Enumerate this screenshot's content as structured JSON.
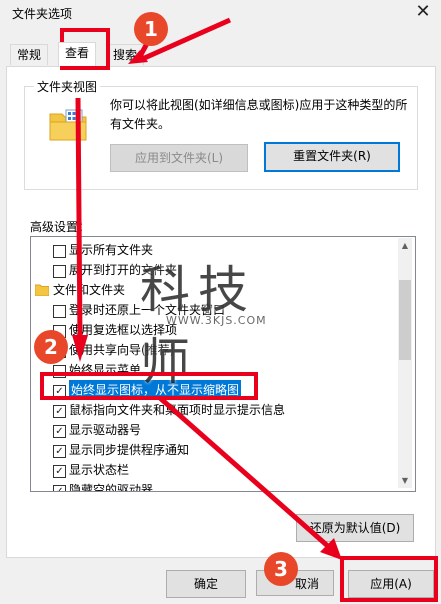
{
  "window": {
    "title": "文件夹选项",
    "close_glyph": "✕"
  },
  "tabs": [
    {
      "label": "常规"
    },
    {
      "label": "查看"
    },
    {
      "label": "搜索"
    }
  ],
  "folder_view": {
    "group_label": "文件夹视图",
    "description": "你可以将此视图(如详细信息或图标)应用于这种类型的所有文件夹。",
    "apply_button": "应用到文件夹(L)",
    "reset_button": "重置文件夹(R)"
  },
  "advanced": {
    "label": "高级设置：",
    "items": [
      {
        "label": "显示所有文件夹",
        "checked": false,
        "indent": 1
      },
      {
        "label": "展开到打开的文件夹",
        "checked": false,
        "indent": 1
      },
      {
        "label": "文件和文件夹",
        "checked": null,
        "indent": 0
      },
      {
        "label": "登录时还原上一个文件夹窗口",
        "checked": false,
        "indent": 1
      },
      {
        "label": "使用复选框以选择项",
        "checked": false,
        "indent": 1
      },
      {
        "label": "使用共享向导(推荐)",
        "checked": false,
        "indent": 1
      },
      {
        "label": "始终显示菜单",
        "checked": false,
        "indent": 1
      },
      {
        "label": "始终显示图标，从不显示缩略图",
        "checked": true,
        "indent": 1,
        "selected": true
      },
      {
        "label": "鼠标指向文件夹和桌面项时显示提示信息",
        "checked": true,
        "indent": 1
      },
      {
        "label": "显示驱动器号",
        "checked": true,
        "indent": 1
      },
      {
        "label": "显示同步提供程序通知",
        "checked": true,
        "indent": 1
      },
      {
        "label": "显示状态栏",
        "checked": true,
        "indent": 1
      },
      {
        "label": "隐藏空的驱动器",
        "checked": true,
        "indent": 1
      }
    ],
    "restore_defaults": "还原为默认值(D)"
  },
  "footer": {
    "ok": "确定",
    "cancel": "取消",
    "apply": "应用(A)"
  },
  "annotations": {
    "step1": "1",
    "step2": "2",
    "step3": "3"
  },
  "watermark": {
    "main": "科技师",
    "url": "WWW.3KJS.COM"
  },
  "colors": {
    "annotation": "#e8001c",
    "badge": "#e8472a",
    "selection": "#0078d7"
  }
}
